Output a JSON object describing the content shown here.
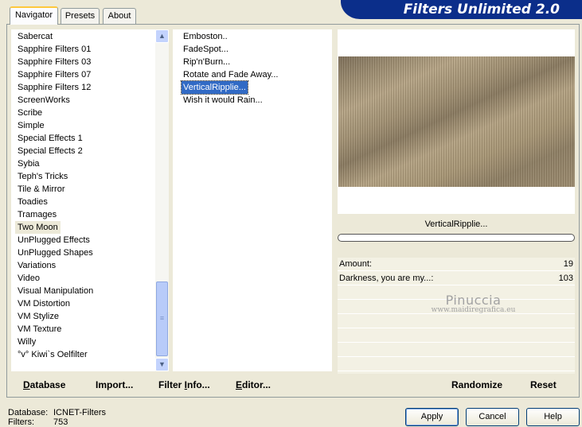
{
  "tabs": [
    "Navigator",
    "Presets",
    "About"
  ],
  "banner_title": "Filters Unlimited 2.0",
  "categories": [
    "Sabercat",
    "Sapphire Filters 01",
    "Sapphire Filters 03",
    "Sapphire Filters 07",
    "Sapphire Filters 12",
    "ScreenWorks",
    "Scribe",
    "Simple",
    "Special Effects 1",
    "Special Effects 2",
    "Sybia",
    "Teph's Tricks",
    "Tile & Mirror",
    "Toadies",
    "Tramages",
    "Two Moon",
    "UnPlugged Effects",
    "UnPlugged Shapes",
    "Variations",
    "Video",
    "Visual Manipulation",
    "VM Distortion",
    "VM Stylize",
    "VM Texture",
    "Willy",
    "°v° Kiwi`s Oelfilter"
  ],
  "selected_category": "Two Moon",
  "filters": [
    "Emboston..",
    "FadeSpot...",
    "Rip'n'Burn...",
    "Rotate and Fade Away...",
    "VerticalRipplie...",
    "Wish it would Rain..."
  ],
  "selected_filter": "VerticalRipplie...",
  "scrollbar_icons": {
    "up": "scroll-up-arrow-icon",
    "down": "scroll-down-arrow-icon"
  },
  "preview_filter_name": "VerticalRipplie...",
  "params": [
    {
      "label": "Amount:",
      "value": "19"
    },
    {
      "label": "Darkness, you are my...:",
      "value": "103"
    }
  ],
  "watermark": {
    "name": "Pinuccia",
    "url": "www.maidiregrafica.eu"
  },
  "buttons": {
    "database": {
      "ul": "D",
      "rest": "atabase"
    },
    "import": {
      "pre": "Import",
      "ul": "",
      "rest": "..."
    },
    "filter_info": {
      "pre": "Filter ",
      "ul": "I",
      "rest": "nfo..."
    },
    "editor": {
      "pre": "",
      "ul": "E",
      "rest": "ditor..."
    },
    "randomize": "Randomize",
    "reset": "Reset",
    "apply": "Apply",
    "cancel": "Cancel",
    "help": "Help"
  },
  "footer": {
    "database_label": "Database:",
    "database_value": "ICNET-Filters",
    "filters_label": "Filters:",
    "filters_value": "753"
  },
  "colors": {
    "banner": "#0b2e8a",
    "selection": "#316ac5",
    "tab_highlight": "#ffc83c"
  }
}
